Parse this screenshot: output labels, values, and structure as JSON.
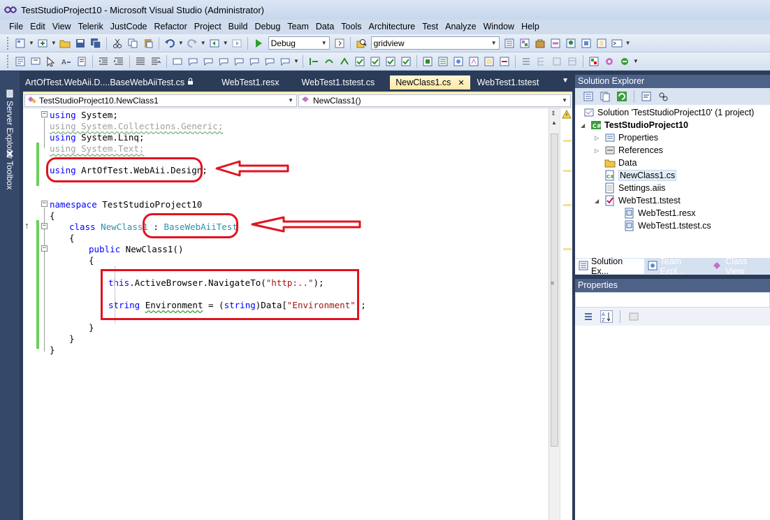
{
  "window": {
    "title": "TestStudioProject10 - Microsoft Visual Studio (Administrator)"
  },
  "menu": [
    "File",
    "Edit",
    "View",
    "Telerik",
    "JustCode",
    "Refactor",
    "Project",
    "Build",
    "Debug",
    "Team",
    "Data",
    "Tools",
    "Architecture",
    "Test",
    "Analyze",
    "Window",
    "Help"
  ],
  "toolbar": {
    "config": "Debug",
    "find_value": "gridview"
  },
  "side_tabs": {
    "server_explorer": "Server Explorer",
    "toolbox": "Toolbox"
  },
  "doc_tabs": [
    {
      "label": "ArtOfTest.WebAii.D....BaseWebAiiTest.cs",
      "locked": true,
      "active": false
    },
    {
      "label": "WebTest1.resx",
      "active": false
    },
    {
      "label": "WebTest1.tstest.cs",
      "active": false
    },
    {
      "label": "NewClass1.cs",
      "active": true
    },
    {
      "label": "WebTest1.tstest",
      "active": false
    }
  ],
  "nav": {
    "type": "TestStudioProject10.NewClass1",
    "member": "NewClass1()"
  },
  "code": {
    "l1_kw": "using",
    "l1_rest": " System;",
    "l2": "using System.Collections.Generic;",
    "l3_kw": "using",
    "l3_rest": " System.Linq;",
    "l4": "using System.Text;",
    "l5_kw": "using",
    "l5_rest": " ArtOfTest.WebAii.Design;",
    "l7_kw": "namespace",
    "l7_rest": " TestStudioProject10",
    "l8": "{",
    "l9_kw": "class",
    "l9_name": "NewClass1",
    "l9_colon": " : ",
    "l9_base": "BaseWebAiiTest",
    "l10": "{",
    "l11_kw": "public",
    "l11_rest": " NewClass1()",
    "l12": "{",
    "l13_kw": "this",
    "l13_rest": ".ActiveBrowser.NavigateTo(",
    "l13_str": "\"http:..\"",
    "l13_end": ");",
    "l15_kw": "string",
    "l15_var": "Environment",
    "l15_mid": " = (",
    "l15_kw2": "string",
    "l15_mid2": ")Data[",
    "l15_str": "\"Environment\"",
    "l15_end": "];",
    "l17": "}",
    "l18": "}",
    "l19": "}"
  },
  "solution_explorer": {
    "title": "Solution Explorer",
    "solution": "Solution 'TestStudioProject10' (1 project)",
    "project": "TestStudioProject10",
    "items": [
      "Properties",
      "References",
      "Data",
      "NewClass1.cs",
      "Settings.aiis",
      "WebTest1.tstest"
    ],
    "children": [
      "WebTest1.resx",
      "WebTest1.tstest.cs"
    ]
  },
  "pane_tabs": [
    "Solution Ex...",
    "Team Expl...",
    "Class View"
  ],
  "properties": {
    "title": "Properties"
  },
  "colors": {
    "annotation_red": "#e0131f",
    "keyword_blue": "#0000ff",
    "type_teal": "#2b91af",
    "string_red": "#a31515",
    "change_green": "#6bcf5a"
  }
}
